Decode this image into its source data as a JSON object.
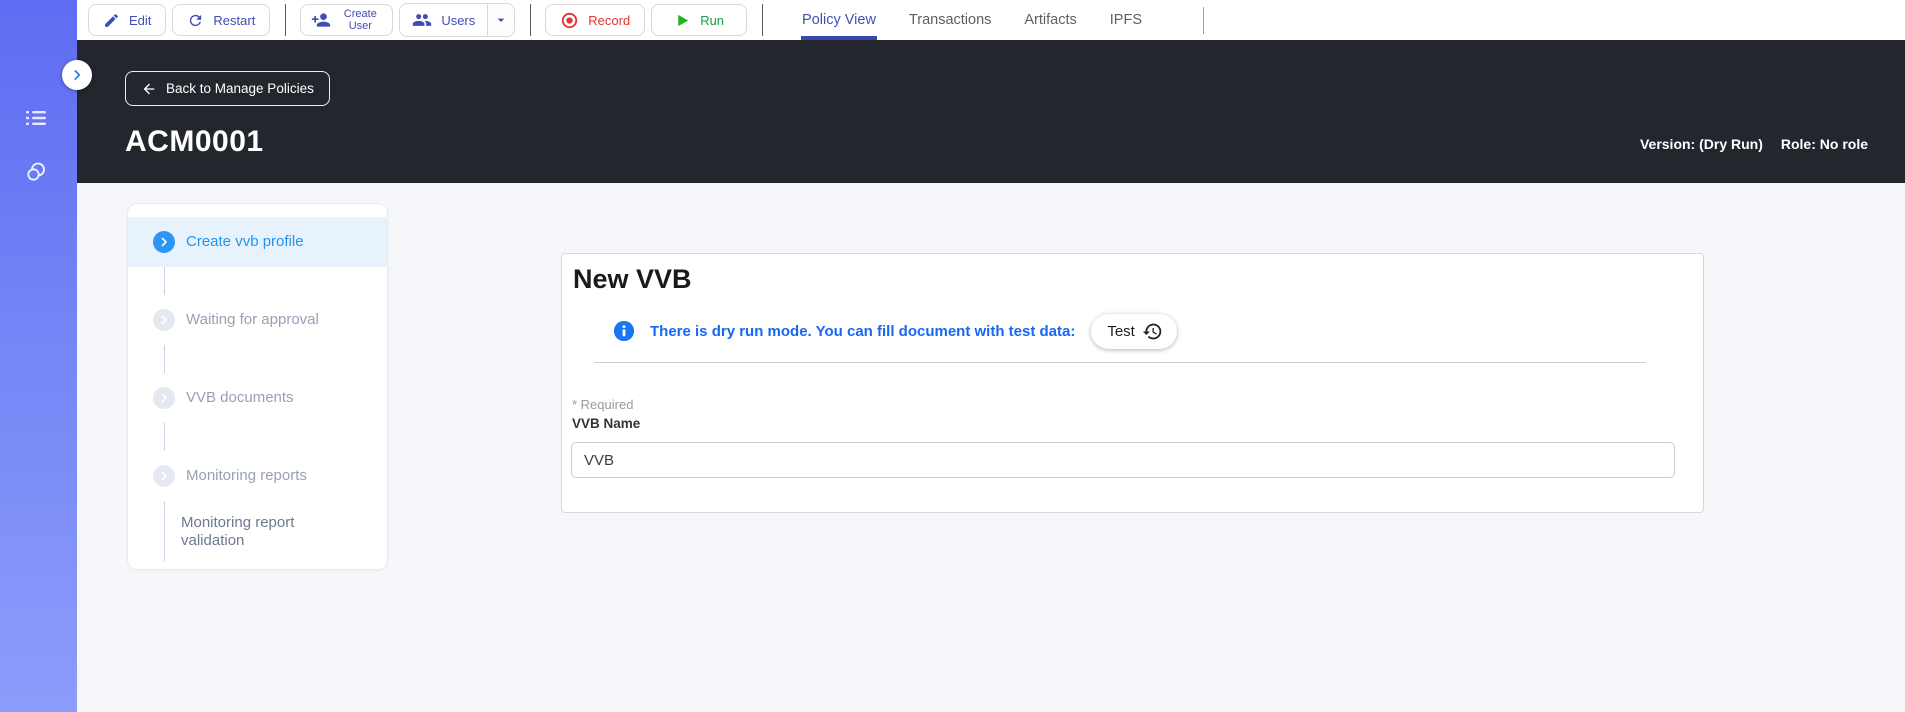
{
  "toolbar": {
    "edit_label": "Edit",
    "restart_label": "Restart",
    "create_user_label": "Create User",
    "users_label": "Users",
    "record_label": "Record",
    "run_label": "Run",
    "tabs": [
      {
        "label": "Policy View",
        "active": true
      },
      {
        "label": "Transactions",
        "active": false
      },
      {
        "label": "Artifacts",
        "active": false
      },
      {
        "label": "IPFS",
        "active": false
      }
    ]
  },
  "header": {
    "back_label": "Back to Manage Policies",
    "title": "ACM0001",
    "version": "Version: (Dry Run)",
    "role": "Role: No role"
  },
  "stepper": {
    "items": [
      {
        "label": "Create vvb profile",
        "state": "active"
      },
      {
        "label": "Waiting for approval",
        "state": "pending"
      },
      {
        "label": "VVB documents",
        "state": "pending"
      },
      {
        "label": "Monitoring reports",
        "state": "pending"
      },
      {
        "label": "Monitoring report validation",
        "state": "sub"
      }
    ]
  },
  "main": {
    "card_title": "New VVB",
    "info_text": "There is dry run mode. You can fill document with test data:",
    "test_button_label": "Test",
    "required_note": "* Required",
    "field_label": "VVB Name",
    "field_value": "VVB"
  },
  "colors": {
    "sidebar_top": "#5e6cf2",
    "sidebar_bottom": "#8c9cfa",
    "header_bg": "#23262d",
    "accent_indigo": "#3f4db4",
    "tab_active": "#3f51b5",
    "record_red": "#e53535",
    "run_green": "#17a24b",
    "step_active_blue": "#2b96f3",
    "step_active_bg": "#e7f2fd",
    "info_blue": "#1667f2",
    "page_bg": "#f6f7fa"
  }
}
